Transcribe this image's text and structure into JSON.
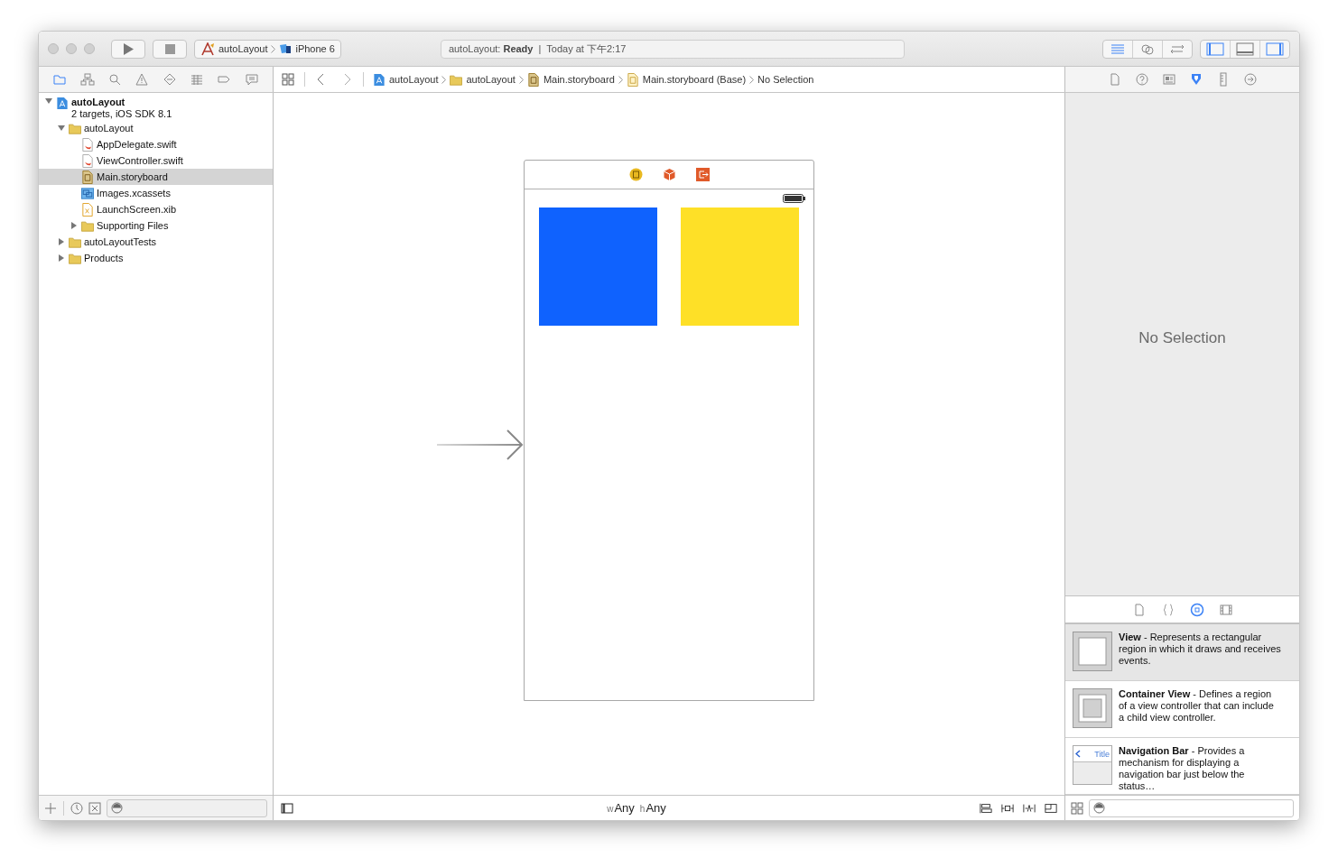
{
  "toolbar": {
    "scheme": "autoLayout",
    "device": "iPhone 6",
    "status": {
      "project": "autoLayout:",
      "state": "Ready",
      "separator": "|",
      "time": "Today at 下午2:17"
    },
    "editor_modes": [
      {
        "kind": "standard",
        "selected": true
      },
      {
        "kind": "assistant",
        "selected": false
      },
      {
        "kind": "version",
        "selected": false
      }
    ],
    "panels": [
      {
        "kind": "left",
        "on": true
      },
      {
        "kind": "bottom",
        "on": false
      },
      {
        "kind": "right",
        "on": true
      }
    ]
  },
  "navigator_tabs": [
    {
      "kind": "folder",
      "selected": true
    },
    {
      "kind": "symbol",
      "selected": false
    },
    {
      "kind": "search",
      "selected": false
    },
    {
      "kind": "issue",
      "selected": false
    },
    {
      "kind": "test",
      "selected": false
    },
    {
      "kind": "debug",
      "selected": false
    },
    {
      "kind": "breakpoint",
      "selected": false
    },
    {
      "kind": "report",
      "selected": false
    }
  ],
  "jump_bar": [
    {
      "label": "autoLayout",
      "kind": "project"
    },
    {
      "label": "autoLayout",
      "kind": "folder"
    },
    {
      "label": "Main.storyboard",
      "kind": "storyboard"
    },
    {
      "label": "Main.storyboard (Base)",
      "kind": "file"
    },
    {
      "label": "No Selection",
      "kind": "none"
    }
  ],
  "tree": [
    {
      "name": "autoLayout",
      "subtitle": "2 targets, iOS SDK 8.1",
      "kind": "project",
      "expanded": true,
      "selected": false,
      "children": [
        {
          "name": "autoLayout",
          "kind": "folder",
          "expanded": true,
          "selected": false,
          "children": [
            {
              "name": "AppDelegate.swift",
              "kind": "swift",
              "selected": false
            },
            {
              "name": "ViewController.swift",
              "kind": "swift",
              "selected": false
            },
            {
              "name": "Main.storyboard",
              "kind": "storyboard",
              "selected": true
            },
            {
              "name": "Images.xcassets",
              "kind": "xcassets",
              "selected": false
            },
            {
              "name": "LaunchScreen.xib",
              "kind": "xib",
              "selected": false
            },
            {
              "name": "Supporting Files",
              "kind": "folder",
              "expanded": false,
              "selected": false
            }
          ]
        },
        {
          "name": "autoLayoutTests",
          "kind": "folder",
          "expanded": false,
          "selected": false
        },
        {
          "name": "Products",
          "kind": "folder",
          "expanded": false,
          "selected": false
        }
      ]
    }
  ],
  "canvas": {
    "views": [
      {
        "color": "#0f62fe"
      },
      {
        "color": "#fee027"
      }
    ],
    "size_class": {
      "w_label": "w",
      "w_value": "Any",
      "h_label": "h",
      "h_value": "Any"
    }
  },
  "inspector_tabs": [
    {
      "kind": "file",
      "selected": false
    },
    {
      "kind": "help",
      "selected": false
    },
    {
      "kind": "identity",
      "selected": false
    },
    {
      "kind": "attributes",
      "selected": true
    },
    {
      "kind": "size",
      "selected": false
    },
    {
      "kind": "connections",
      "selected": false
    }
  ],
  "inspector": {
    "message": "No Selection"
  },
  "library_tabs": [
    {
      "kind": "file",
      "selected": false
    },
    {
      "kind": "code",
      "selected": false
    },
    {
      "kind": "object",
      "selected": true
    },
    {
      "kind": "media",
      "selected": false
    }
  ],
  "library": [
    {
      "kind": "view",
      "text": "**View** - Represents a rectangular region in which it draws and receives events.",
      "selected": true
    },
    {
      "kind": "container",
      "text": "**Container View** - Defines a region of a view controller that can include a child view controller.",
      "selected": false
    },
    {
      "kind": "navbar",
      "icon_label": "Title",
      "text": "**Navigation Bar** - Provides a mechanism for displaying a navigation bar just below the status…",
      "selected": false
    }
  ]
}
